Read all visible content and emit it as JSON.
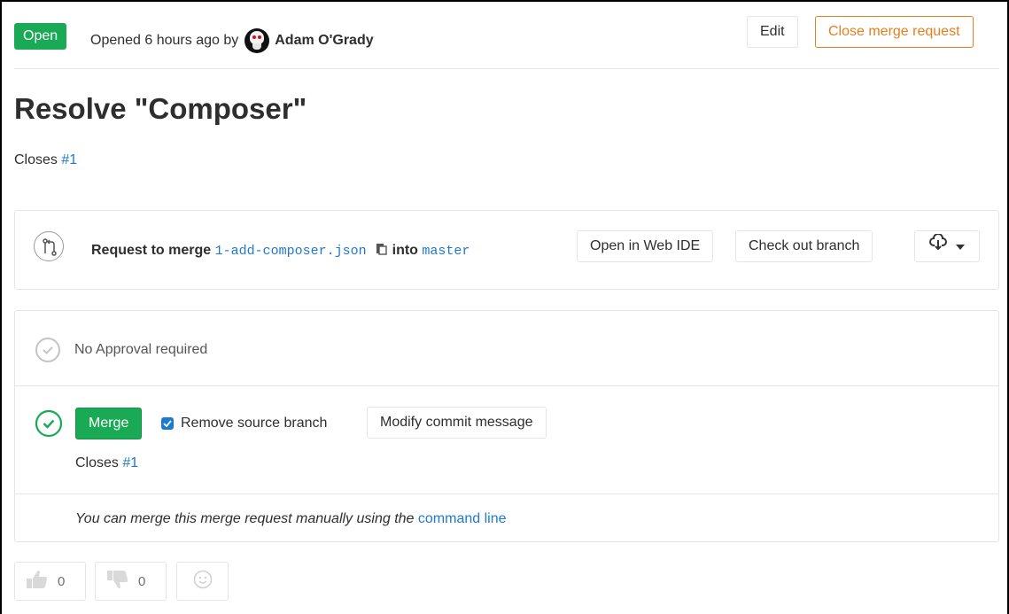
{
  "header": {
    "status": "Open",
    "opened_prefix": "Opened 6 hours ago by",
    "author": "Adam O'Grady",
    "edit_label": "Edit",
    "close_label": "Close merge request"
  },
  "title": "Resolve \"Composer\"",
  "description": {
    "closes_prefix": "Closes",
    "issue_ref": "#1"
  },
  "branch": {
    "request_prefix": "Request to merge",
    "source_branch": "1-add-composer.json",
    "into_word": "into",
    "target_branch": "master",
    "web_ide_label": "Open in Web IDE",
    "checkout_label": "Check out branch",
    "download_icon": "cloud-download-icon"
  },
  "approval": {
    "text": "No Approval required"
  },
  "merge": {
    "merge_label": "Merge",
    "remove_source_label": "Remove source branch",
    "remove_source_checked": true,
    "modify_commit_label": "Modify commit message",
    "closes_prefix": "Closes",
    "issue_ref": "#1"
  },
  "cmdline": {
    "text": "You can merge this merge request manually using the",
    "link": "command line"
  },
  "awards": {
    "thumbsup_count": "0",
    "thumbsdown_count": "0"
  },
  "colors": {
    "success": "#1aaa55",
    "link": "#1f78d1",
    "warning": "#e67e22",
    "border": "#e5e5e5"
  }
}
